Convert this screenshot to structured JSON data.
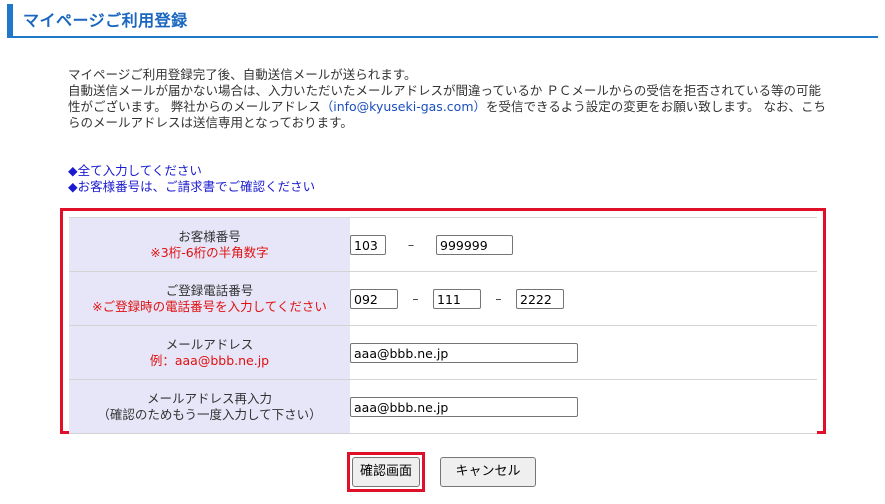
{
  "header": {
    "title": "マイページご利用登録"
  },
  "intro": {
    "line1": "マイページご利用登録完了後、自動送信メールが送られます。",
    "line2_a": "自動送信メールが届かない場合は、入力いただいたメールアドレスが間違っているか ＰＣメールからの受信を拒否されている等の可能性がございます。 弊社からのメールアドレス",
    "email": "（info@kyuseki-gas.com）",
    "line2_b": "を受信できるよう設定の変更をお願い致します。 なお、こちらのメールアドレスは送信専用となっております。"
  },
  "notes": [
    "◆全て入力してください",
    "◆お客様番号は、ご請求書でご確認ください"
  ],
  "form": {
    "customer_number": {
      "label": "お客様番号",
      "sub": "※3桁-6桁の半角数字",
      "part1": "103",
      "separator": "–",
      "part2": "999999"
    },
    "phone": {
      "label": "ご登録電話番号",
      "sub": "※ご登録時の電話番号を入力してください",
      "part1": "092",
      "part2": "111",
      "part3": "2222",
      "separator": "–"
    },
    "email": {
      "label": "メールアドレス",
      "sub": "例：aaa@bbb.ne.jp",
      "value": "aaa@bbb.ne.jp"
    },
    "email_confirm": {
      "label": "メールアドレス再入力",
      "sub": "（確認のためもう一度入力して下さい）",
      "value": "aaa@bbb.ne.jp"
    }
  },
  "buttons": {
    "confirm": "確認画面",
    "cancel": "キャンセル"
  },
  "colors": {
    "accent": "#1f78c8",
    "highlight": "#e0102a",
    "label_bg": "#e6e6f8",
    "link": "#1a4fc0"
  }
}
